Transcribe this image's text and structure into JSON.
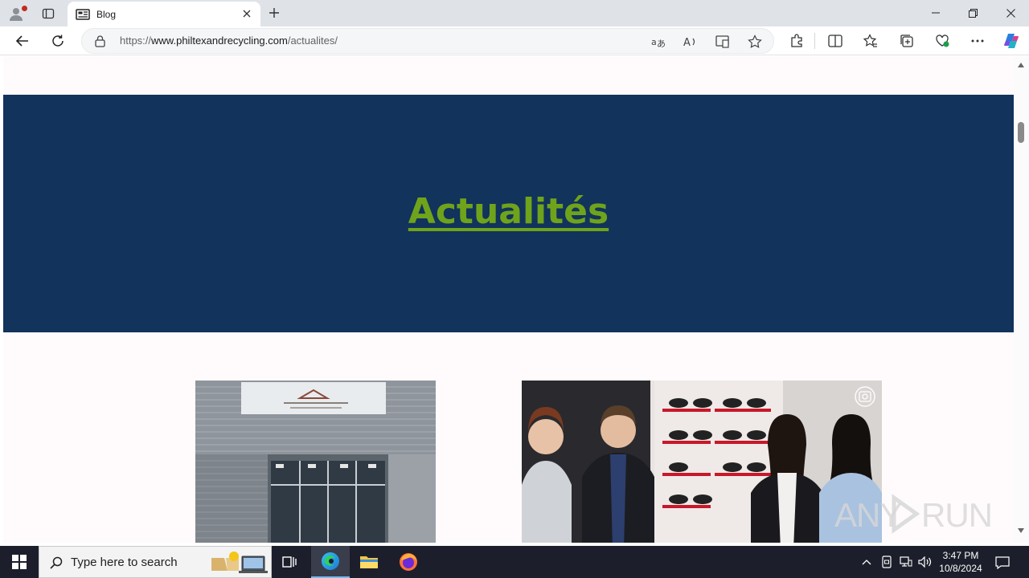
{
  "browser": {
    "tab": {
      "title": "Blog",
      "favicon": "news-icon"
    },
    "address": {
      "scheme": "https://",
      "host": "www.philtexandrecycling.com",
      "path": "/actualites/"
    },
    "colors": {
      "tab_strip": "#dfe3e8",
      "toolbar": "#ffffff"
    }
  },
  "page": {
    "hero": {
      "title": "Actualités"
    },
    "colors": {
      "hero_bg": "#11335c",
      "title": "#6fa31b",
      "page_bg": "#fffbfc"
    },
    "images": [
      {
        "name": "store-front-image",
        "description_icon": "shop-icon"
      },
      {
        "name": "team-photo-image",
        "description_icon": "photo-icon"
      }
    ],
    "watermark": "ANY.RUN"
  },
  "taskbar": {
    "search_placeholder": "Type here to search",
    "clock": {
      "time": "3:47 PM",
      "date": "10/8/2024"
    },
    "colors": {
      "bg": "#1c1f2b",
      "accent": "#76b9ed"
    }
  }
}
